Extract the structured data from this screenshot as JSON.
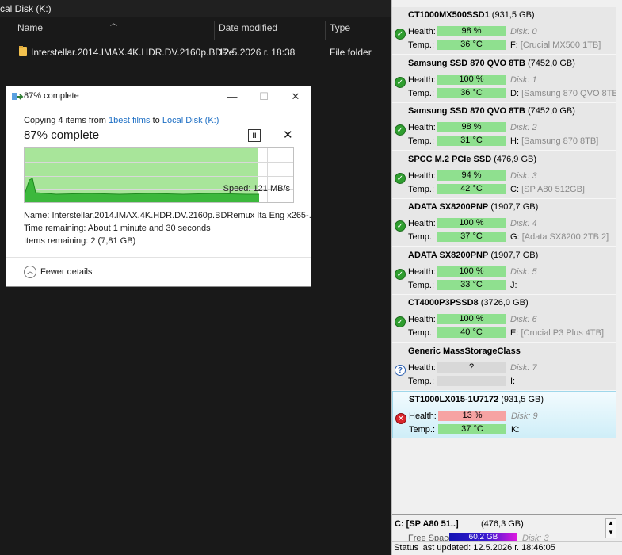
{
  "explorer": {
    "location": "cal Disk (K:)",
    "columns": {
      "name": "Name",
      "date_modified": "Date modified",
      "type": "Type"
    },
    "rows": [
      {
        "name": "Interstellar.2014.IMAX.4K.HDR.DV.2160p.BDRe...",
        "date": "12.5.2026 г. 18:38",
        "type": "File folder"
      }
    ]
  },
  "dialog": {
    "title": "87% complete",
    "copying_prefix": "Copying 4 items from ",
    "source": "1best films",
    "to_word": " to ",
    "destination": "Local Disk (K:)",
    "percent_label": "87% complete",
    "progress": 0.87,
    "speed": "Speed: 121 MB/s",
    "name_line": "Name:  Interstellar.2014.IMAX.4K.HDR.DV.2160p.BDRemux Ita Eng x265-...",
    "time_line": "Time remaining:  About 1 minute and 30 seconds",
    "items_line": "Items remaining:  2 (7,81 GB)",
    "fewer_details": "Fewer details",
    "pause_glyph": "II",
    "cancel_glyph": "✕",
    "minimize_glyph": "—",
    "maximize_glyph": "☐",
    "close_glyph": "✕",
    "chevron_glyph": "︿"
  },
  "cdi": {
    "health_label": "Health:",
    "temp_label": "Temp.:",
    "disks": [
      {
        "model": "CT1000MX500SSD1",
        "size": " (931,5 GB)",
        "health": "98 %",
        "temp": "36 °C",
        "disk_index": "Disk: 0",
        "drive_letter": "F:",
        "drive_name": "[Crucial MX500 1TB]",
        "status": "ok",
        "status_glyph": "✓"
      },
      {
        "model": "Samsung SSD 870 QVO 8TB",
        "size": " (7452,0 GB)",
        "health": "100 %",
        "temp": "36 °C",
        "disk_index": "Disk: 1",
        "drive_letter": "D:",
        "drive_name": "[Samsung 870 QVO 8TB]",
        "status": "ok",
        "status_glyph": "✓"
      },
      {
        "model": "Samsung SSD 870 QVO 8TB",
        "size": " (7452,0 GB)",
        "health": "98 %",
        "temp": "31 °C",
        "disk_index": "Disk: 2",
        "drive_letter": "H:",
        "drive_name": "[Samsung 870 8TB]",
        "status": "ok",
        "status_glyph": "✓"
      },
      {
        "model": "SPCC M.2 PCIe SSD",
        "size": " (476,9 GB)",
        "health": "94 %",
        "temp": "42 °C",
        "disk_index": "Disk: 3",
        "drive_letter": "C:",
        "drive_name": "[SP A80 512GB]",
        "status": "ok",
        "status_glyph": "✓"
      },
      {
        "model": "ADATA SX8200PNP",
        "size": " (1907,7 GB)",
        "health": "100 %",
        "temp": "37 °C",
        "disk_index": "Disk: 4",
        "drive_letter": "G:",
        "drive_name": "[Adata SX8200 2TB 2]",
        "status": "ok",
        "status_glyph": "✓"
      },
      {
        "model": "ADATA SX8200PNP",
        "size": " (1907,7 GB)",
        "health": "100 %",
        "temp": "33 °C",
        "disk_index": "Disk: 5",
        "drive_letter": "J:",
        "drive_name": "",
        "status": "ok",
        "status_glyph": "✓"
      },
      {
        "model": "CT4000P3PSSD8",
        "size": " (3726,0 GB)",
        "health": "100 %",
        "temp": "40 °C",
        "disk_index": "Disk: 6",
        "drive_letter": "E:",
        "drive_name": "[Crucial P3 Plus 4TB]",
        "status": "ok",
        "status_glyph": "✓"
      },
      {
        "model": "Generic MassStorageClass",
        "size": "",
        "health": "?",
        "temp": "",
        "disk_index": "Disk: 7",
        "drive_letter": "I:",
        "drive_name": "",
        "status": "unknown",
        "status_glyph": "?"
      },
      {
        "model": "ST1000LX015-1U7172",
        "size": " (931,5 GB)",
        "health": "13 %",
        "temp": "37 °C",
        "disk_index": "Disk: 9",
        "drive_letter": "K:",
        "drive_name": "",
        "status": "bad",
        "status_glyph": "✕"
      }
    ],
    "volume": {
      "name": "C: [SP A80 51..]",
      "size": "(476,3 GB)",
      "free_label": "Free Space",
      "free_value": "60,2 GB",
      "disk_hint": "Disk: 3"
    },
    "status_bar": "Status last updated: 12.5.2026 г. 18:46:05",
    "colors": {
      "good": "#8fe08f",
      "bad": "#f6a3a3",
      "unknown": "#d8d8d8"
    }
  }
}
